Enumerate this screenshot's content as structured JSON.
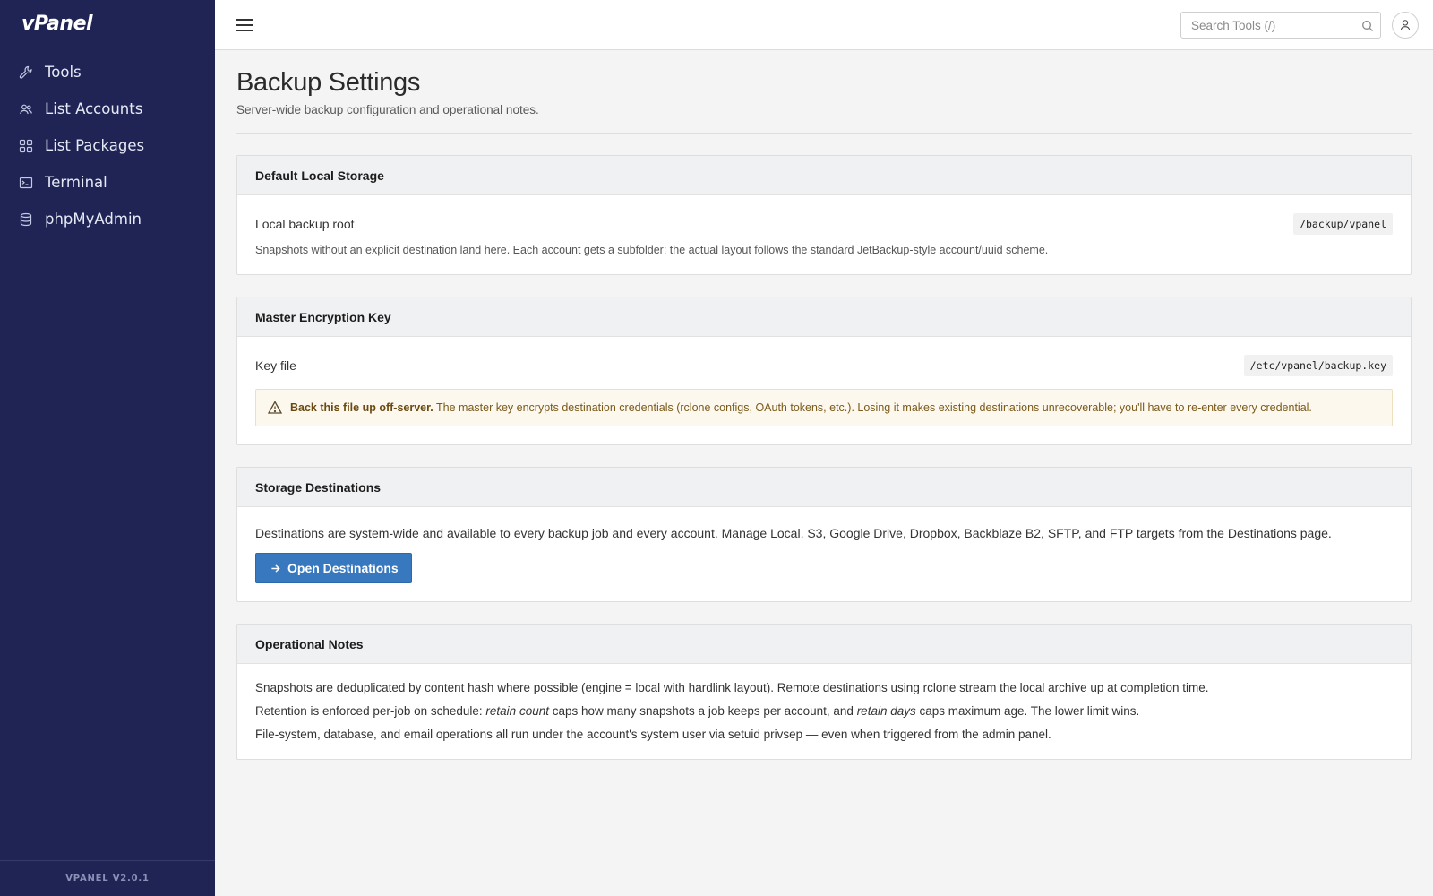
{
  "app": {
    "logo_text": "vPanel",
    "version": "VPANEL V2.0.1"
  },
  "sidebar": {
    "items": [
      {
        "label": "Tools",
        "icon": "wrench-icon"
      },
      {
        "label": "List Accounts",
        "icon": "users-icon"
      },
      {
        "label": "List Packages",
        "icon": "grid-icon"
      },
      {
        "label": "Terminal",
        "icon": "terminal-icon"
      },
      {
        "label": "phpMyAdmin",
        "icon": "database-icon"
      }
    ]
  },
  "topbar": {
    "search_placeholder": "Search Tools (/)"
  },
  "page": {
    "title": "Backup Settings",
    "subtitle": "Server-wide backup configuration and operational notes."
  },
  "cards": {
    "local_storage": {
      "title": "Default Local Storage",
      "label": "Local backup root",
      "value": "/backup/vpanel",
      "help": "Snapshots without an explicit destination land here. Each account gets a subfolder; the actual layout follows the standard JetBackup-style account/uuid scheme."
    },
    "encryption": {
      "title": "Master Encryption Key",
      "label": "Key file",
      "value": "/etc/vpanel/backup.key",
      "warning_strong": "Back this file up off-server.",
      "warning_text": "The master key encrypts destination credentials (rclone configs, OAuth tokens, etc.). Losing it makes existing destinations unrecoverable; you'll have to re-enter every credential."
    },
    "destinations": {
      "title": "Storage Destinations",
      "text": "Destinations are system-wide and available to every backup job and every account. Manage Local, S3, Google Drive, Dropbox, Backblaze B2, SFTP, and FTP targets from the Destinations page.",
      "button_label": "Open Destinations"
    },
    "notes": {
      "title": "Operational Notes",
      "line1": "Snapshots are deduplicated by content hash where possible (engine = local with hardlink layout). Remote destinations using rclone stream the local archive up at completion time.",
      "line2_a": "Retention is enforced per-job on schedule: ",
      "line2_em1": "retain count",
      "line2_b": " caps how many snapshots a job keeps per account, and ",
      "line2_em2": "retain days",
      "line2_c": " caps maximum age. The lower limit wins.",
      "line3": "File-system, database, and email operations all run under the account's system user via setuid privsep — even when triggered from the admin panel."
    }
  },
  "colors": {
    "sidebar_bg": "#1f2454",
    "primary": "#3778be",
    "warning_bg": "#fdf8ee"
  }
}
